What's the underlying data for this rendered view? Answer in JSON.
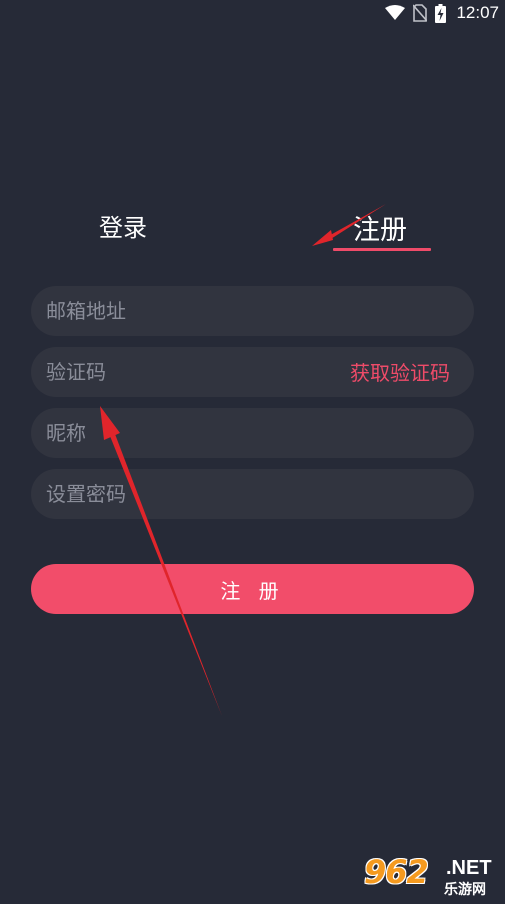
{
  "status_bar": {
    "time": "12:07",
    "icons": [
      "wifi-icon",
      "no-sim-icon",
      "battery-charging-icon"
    ]
  },
  "tabs": {
    "login_label": "登录",
    "register_label": "注册",
    "active": "register"
  },
  "form": {
    "email_placeholder": "邮箱地址",
    "code_placeholder": "验证码",
    "get_code_label": "获取验证码",
    "nickname_placeholder": "昵称",
    "password_placeholder": "设置密码"
  },
  "submit": {
    "label": "注 册"
  },
  "watermark": {
    "brand": "962",
    "domain": ".NET",
    "site_name": "乐游网"
  },
  "colors": {
    "background": "#262a37",
    "field_background": "#31343f",
    "accent": "#f24d6a",
    "annotation_arrow": "#e0252b"
  }
}
